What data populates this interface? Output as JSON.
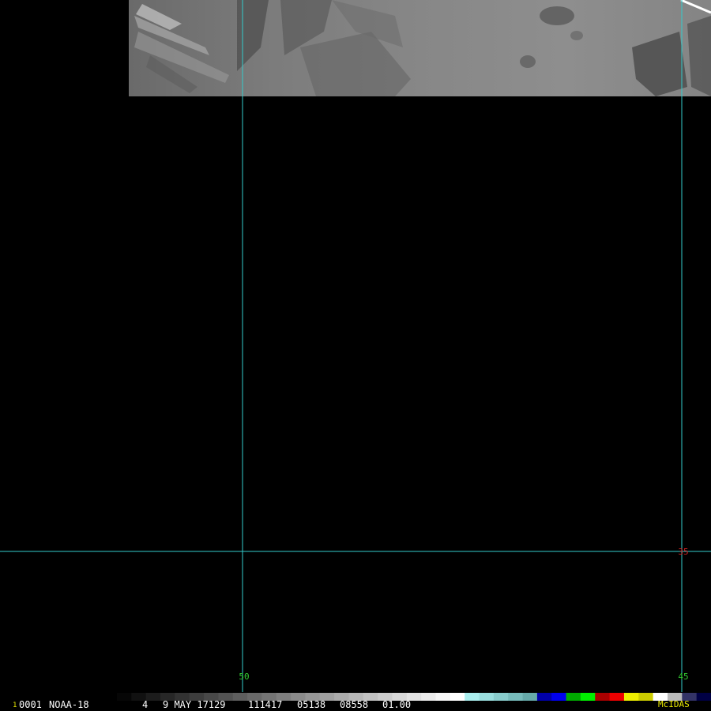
{
  "image": {
    "satellite": "NOAA-18",
    "frame": "0001",
    "frame_prefix": "1",
    "band": "4",
    "date": "9 MAY 17129",
    "time": "111417",
    "line": "05138",
    "element": "08558",
    "resolution": "01.00",
    "software": "McIDAS"
  },
  "grid": {
    "longitude_labels": [
      "50",
      "45"
    ],
    "latitude_labels": [
      "35"
    ],
    "line_color": "#33cccc",
    "lon_label_color": "#33cc33",
    "lat_label_color": "#cc2222"
  },
  "colors": {
    "background": "#000000",
    "software_label": "#e8e800",
    "status_text": "#ffffff",
    "frame_prefix": "#e8e800"
  },
  "color_bar": {
    "segments": [
      "#060606",
      "#111111",
      "#1c1c1c",
      "#272727",
      "#323232",
      "#3d3d3d",
      "#484848",
      "#535353",
      "#5e5e5e",
      "#696969",
      "#747474",
      "#7f7f7f",
      "#8a8a8a",
      "#959595",
      "#a0a0a0",
      "#ababab",
      "#b6b6b6",
      "#c1c1c1",
      "#cccccc",
      "#d7d7d7",
      "#e2e2e2",
      "#ededed",
      "#f8f8f8",
      "#ffffff",
      "#aaeeee",
      "#99dddd",
      "#88cccc",
      "#77bbbb",
      "#66aaaa",
      "#0000aa",
      "#0000ee",
      "#00aa00",
      "#00ee00",
      "#aa0000",
      "#ee0000",
      "#eeee00",
      "#cccc00",
      "#ffffff",
      "#bbbbbb",
      "#333366",
      "#000044"
    ]
  }
}
